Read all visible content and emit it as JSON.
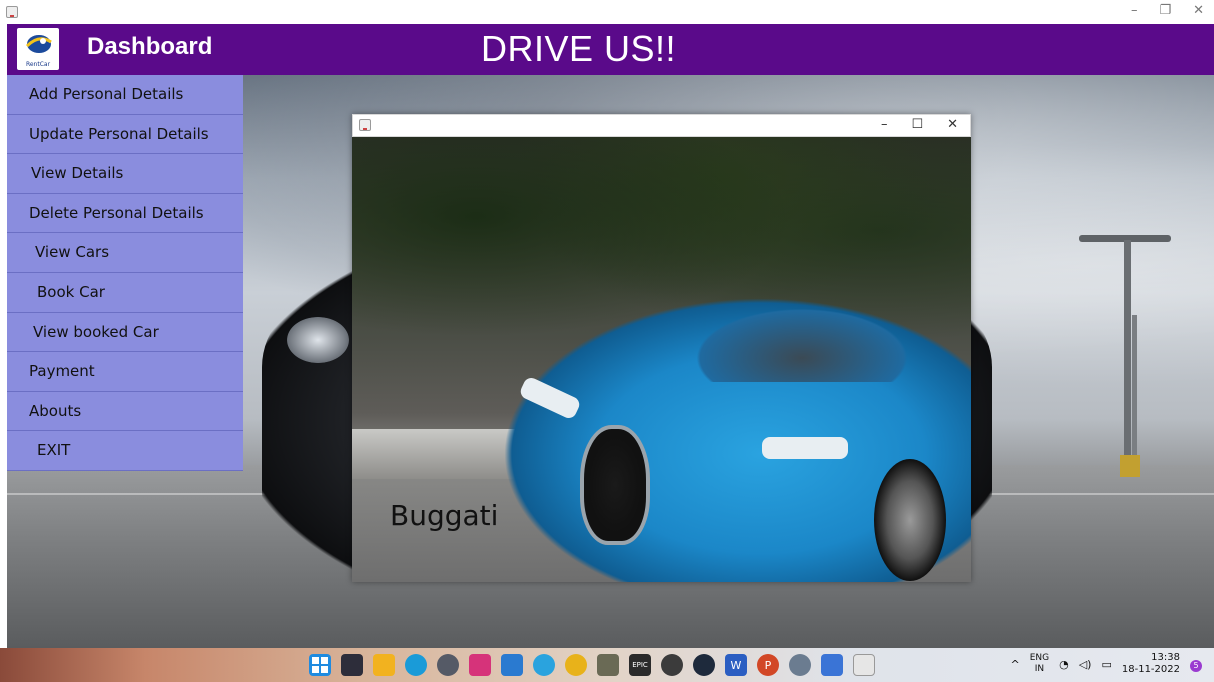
{
  "window": {
    "controls": {
      "minimize": "–",
      "restore": "❐",
      "close": "✕"
    }
  },
  "header": {
    "logo_text": "RentCar",
    "dashboard_title": "Dashboard",
    "app_title": "DRIVE US!!",
    "bg_color": "#5a0a8a"
  },
  "sidebar": {
    "bg_color": "#8a8dde",
    "items": [
      {
        "label": "Add Personal Details"
      },
      {
        "label": "Update Personal Details"
      },
      {
        "label": "View Details"
      },
      {
        "label": "Delete Personal Details"
      },
      {
        "label": "View Cars"
      },
      {
        "label": "Book Car"
      },
      {
        "label": "View booked Car"
      },
      {
        "label": "Payment"
      },
      {
        "label": "Abouts"
      },
      {
        "label": "EXIT"
      }
    ]
  },
  "dialog": {
    "controls": {
      "minimize": "–",
      "maximize": "☐",
      "close": "✕"
    },
    "car_label": "Buggati"
  },
  "taskbar": {
    "icons": [
      "start-icon",
      "taskview-icon",
      "file-explorer-icon",
      "edge-icon",
      "app-icon",
      "instagram-icon",
      "vscode-icon",
      "telegram-icon",
      "chrome-icon",
      "gta-icon",
      "epic-games-icon",
      "xbox-icon",
      "steam-icon",
      "word-icon",
      "powerpoint-icon",
      "settings-icon",
      "app2-icon",
      "java-icon"
    ],
    "icon_labels": {
      "epic": "EPIC",
      "word": "W",
      "ppt": "P"
    },
    "tray": {
      "lang_line1": "ENG",
      "lang_line2": "IN",
      "time": "13:38",
      "date": "18-11-2022",
      "notif_count": "5",
      "chevron": "^"
    }
  }
}
